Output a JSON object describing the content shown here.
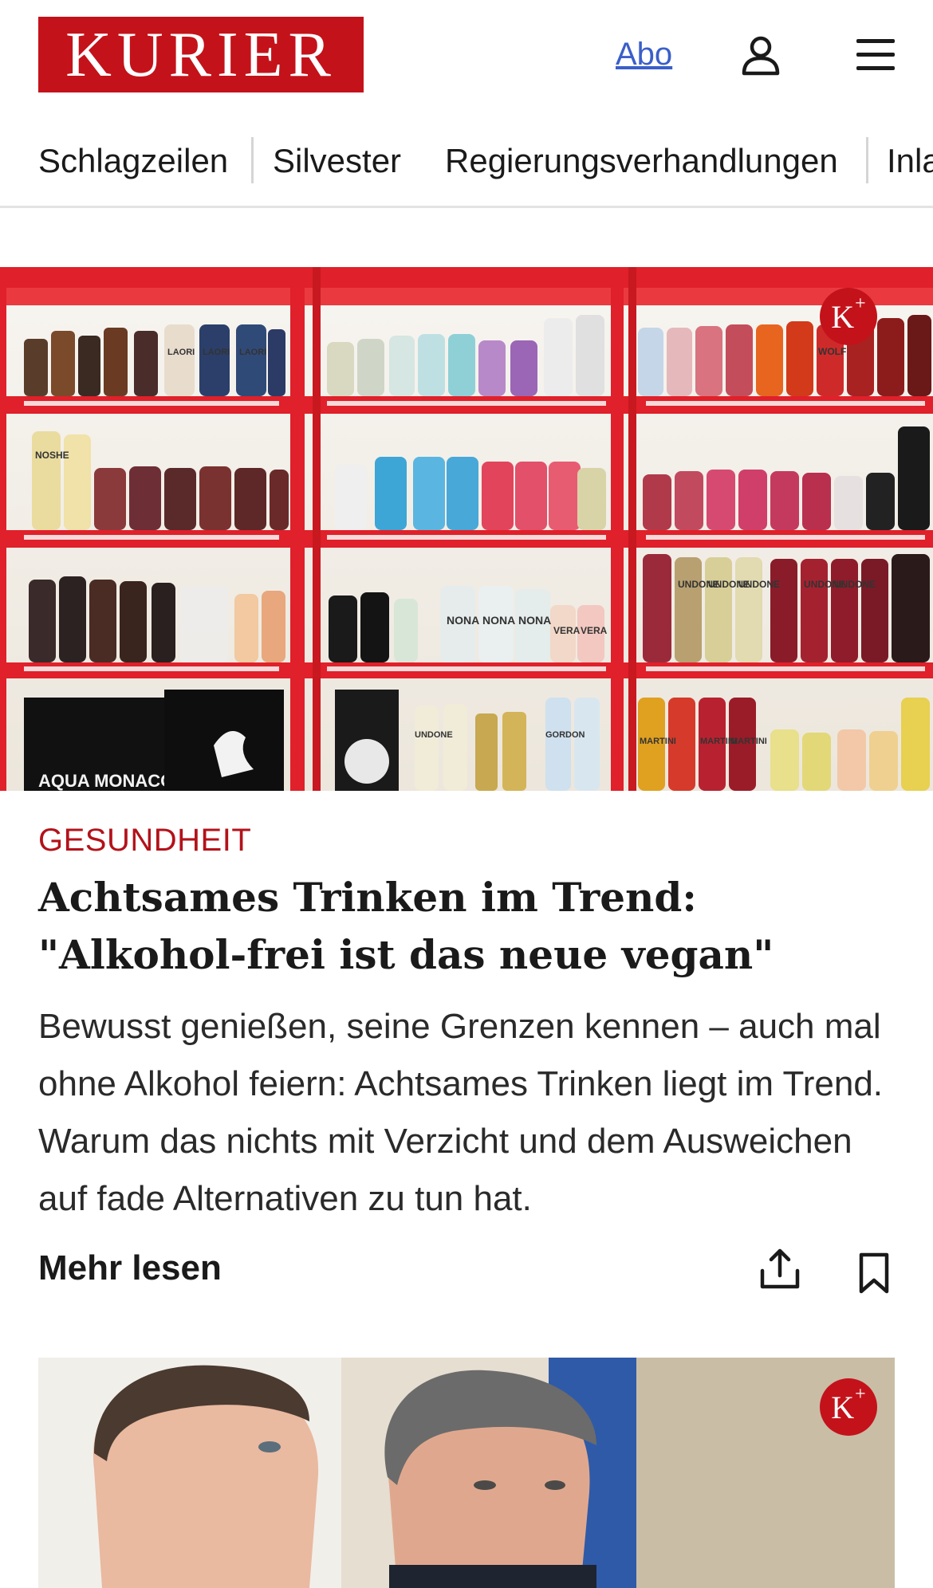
{
  "header": {
    "logo_text": "KURIER",
    "abo_link": "Abo",
    "user_icon": "user-icon",
    "menu_icon": "hamburger-menu-icon",
    "brand_color": "#c4121a"
  },
  "nav": {
    "items": [
      "Schlagzeilen",
      "Silvester",
      "Regierungsverhandlungen",
      "Inland"
    ]
  },
  "article1": {
    "badge": "K+",
    "kicker": "GESUNDHEIT",
    "headline": "Achtsames Trinken im Trend: \"Alkohol-frei ist das neue vegan\"",
    "teaser": "Bewusst genießen, seine Grenzen kennen – auch mal ohne Alkohol feiern: Achtsames Trinken liegt im Trend. Warum das nichts mit Verzicht und dem Ausweichen auf fade Alternativen zu tun hat.",
    "more_label": "Mehr lesen",
    "share_icon": "share-icon",
    "bookmark_icon": "bookmark-icon",
    "image_labels": [
      "AQUA MONACO",
      "NONA",
      "NONA",
      "NONA",
      "VERA",
      "VERA",
      "UNDONE",
      "UNDONE",
      "UNDONE",
      "UNDONE",
      "UNDONE",
      "UNDONE",
      "GORDON",
      "MARTINI",
      "MARTINI",
      "MARTINI",
      "LAORI",
      "LAORI",
      "LAORI",
      "NOSHE",
      "WOLF"
    ]
  },
  "article2": {
    "badge": "K+"
  }
}
